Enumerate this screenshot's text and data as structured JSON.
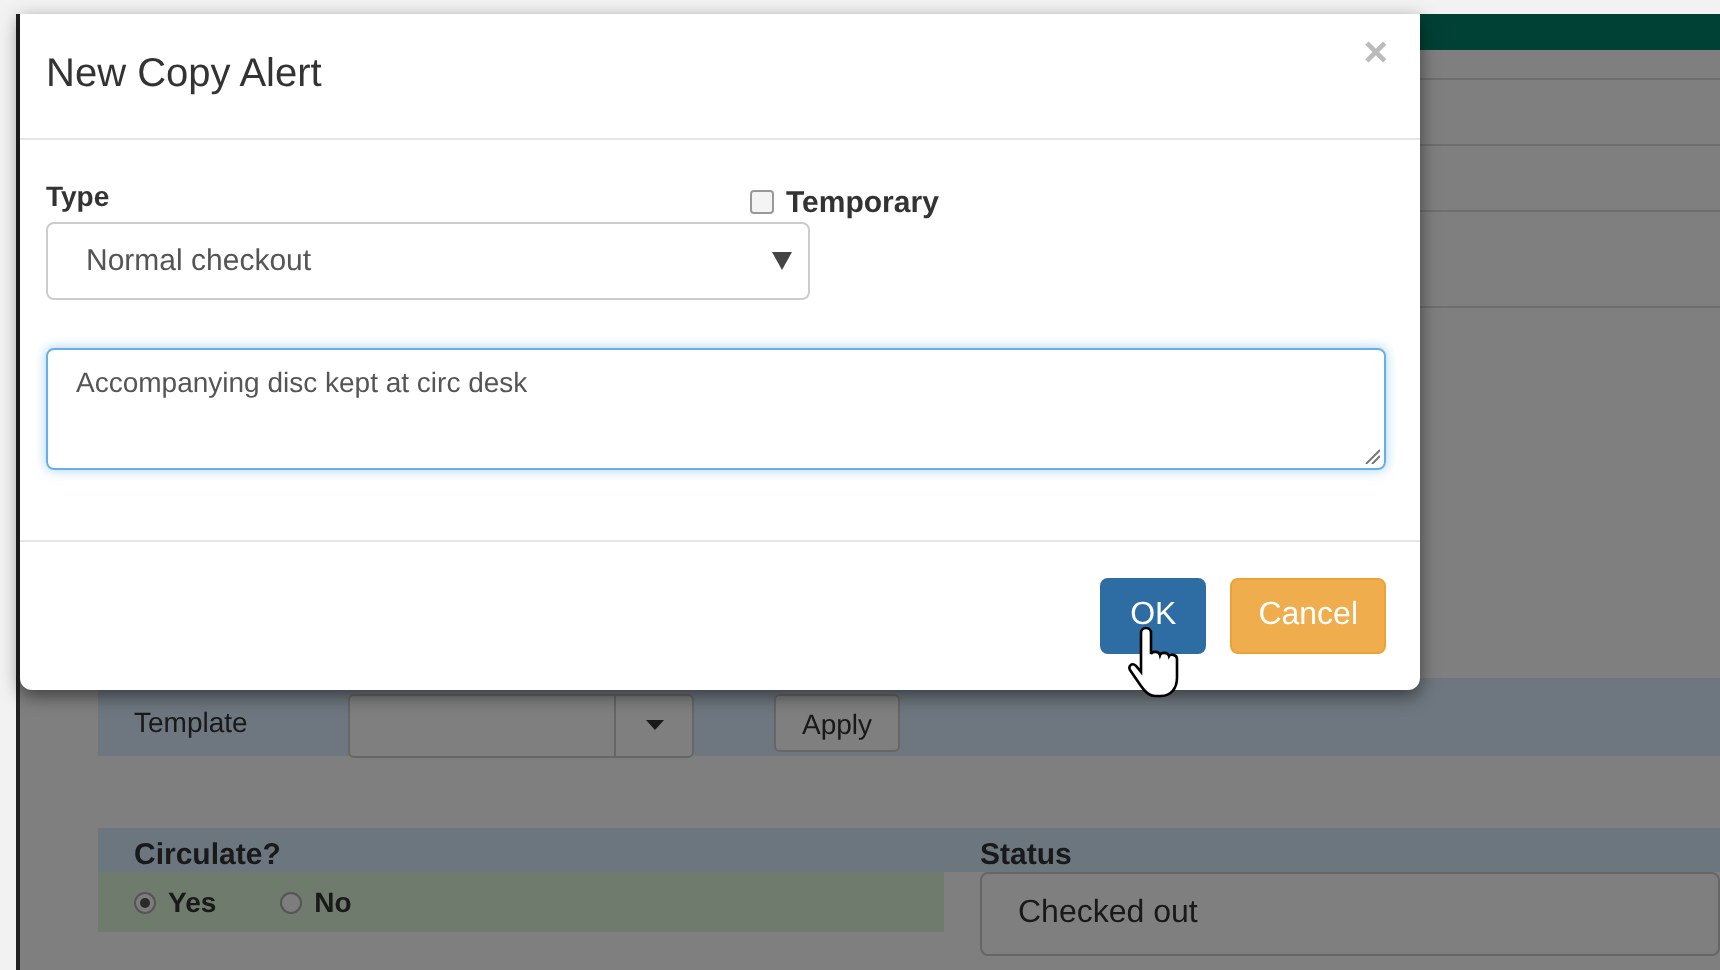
{
  "background": {
    "template": {
      "label": "Template",
      "button": "Apply"
    },
    "circulate": {
      "label": "Circulate?",
      "options": [
        {
          "label": "Yes",
          "selected": true
        },
        {
          "label": "No",
          "selected": false
        }
      ]
    },
    "status": {
      "label": "Status",
      "value": "Checked out"
    }
  },
  "dialog": {
    "title": "New Copy Alert",
    "close": "×",
    "type_label": "Type",
    "type_value": "Normal checkout",
    "temporary": {
      "label": "Temporary",
      "checked": false
    },
    "note": "Accompanying disc kept at circ desk",
    "buttons": [
      {
        "label": "OK",
        "kind": "primary"
      },
      {
        "label": "Cancel",
        "kind": "warning"
      }
    ]
  }
}
